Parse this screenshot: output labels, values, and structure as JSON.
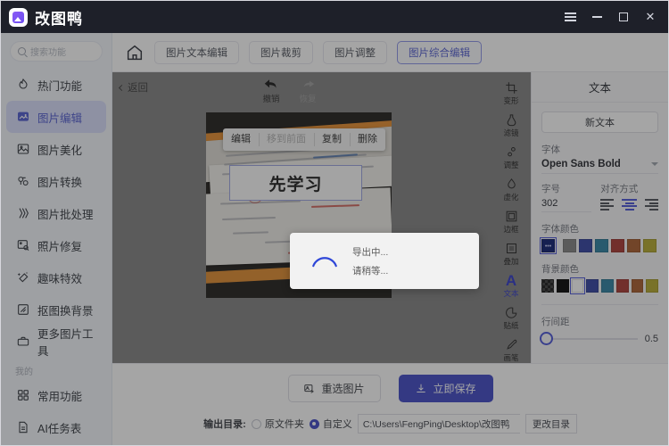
{
  "window": {
    "app_title": "改图鸭",
    "logo_icon": "duck-logo-icon",
    "menu_icon": "hamburger-menu-icon",
    "minimize_icon": "minimize-icon",
    "maximize_icon": "maximize-icon",
    "close_icon": "close-icon",
    "close_label": "✕"
  },
  "sidebar": {
    "search": {
      "placeholder": "搜索功能",
      "icon": "search-icon"
    },
    "items": [
      {
        "label": "热门功能",
        "icon": "flame-icon",
        "active": false
      },
      {
        "label": "图片编辑",
        "icon": "image-edit-icon",
        "active": true
      },
      {
        "label": "图片美化",
        "icon": "image-beautify-icon",
        "active": false
      },
      {
        "label": "图片转换",
        "icon": "image-convert-icon",
        "active": false
      },
      {
        "label": "图片批处理",
        "icon": "batch-process-icon",
        "active": false
      },
      {
        "label": "照片修复",
        "icon": "photo-repair-icon",
        "active": false
      },
      {
        "label": "趣味特效",
        "icon": "sparkle-effect-icon",
        "active": false
      },
      {
        "label": "抠图换背景",
        "icon": "cutout-background-icon",
        "active": false
      },
      {
        "label": "更多图片工具",
        "icon": "toolbox-icon",
        "active": false
      }
    ],
    "group_label": "我的",
    "my_items": [
      {
        "label": "常用功能",
        "icon": "grid-icon"
      },
      {
        "label": "AI任务表",
        "icon": "document-icon"
      }
    ]
  },
  "tabbar": {
    "home_icon": "home-icon",
    "tabs": [
      {
        "label": "图片文本编辑",
        "active": false
      },
      {
        "label": "图片裁剪",
        "active": false
      },
      {
        "label": "图片调整",
        "active": false
      },
      {
        "label": "图片综合编辑",
        "active": true
      }
    ]
  },
  "canvas": {
    "back_label": "返回",
    "back_icon": "chevron-left-icon",
    "undo": {
      "label": "撤销",
      "icon": "undo-arrow-icon",
      "enabled": true
    },
    "redo": {
      "label": "恢复",
      "icon": "redo-arrow-icon",
      "enabled": false
    },
    "context_menu": [
      {
        "label": "编辑",
        "disabled": false
      },
      {
        "label": "移到前面",
        "disabled": true
      },
      {
        "label": "复制",
        "disabled": false
      },
      {
        "label": "删除",
        "disabled": false
      }
    ],
    "text_overlay": "先学习"
  },
  "modal": {
    "title": "导出中...",
    "subtitle": "请稍等...",
    "spinner_icon": "loading-spinner-icon",
    "spinner_color": "#2f47d8"
  },
  "toolrail": [
    {
      "label": "变形",
      "icon": "transform-icon",
      "active": false
    },
    {
      "label": "滤镜",
      "icon": "filter-icon",
      "active": false
    },
    {
      "label": "调整",
      "icon": "adjust-icon",
      "active": false
    },
    {
      "label": "虚化",
      "icon": "blur-icon",
      "active": false
    },
    {
      "label": "边框",
      "icon": "border-icon",
      "active": false
    },
    {
      "label": "叠加",
      "icon": "overlay-icon",
      "active": false
    },
    {
      "label": "文本",
      "icon": "text-icon",
      "active": true
    },
    {
      "label": "贴纸",
      "icon": "sticker-icon",
      "active": false
    },
    {
      "label": "画笔",
      "icon": "brush-icon",
      "active": false
    }
  ],
  "props": {
    "title": "文本",
    "new_text_label": "新文本",
    "font_label": "字体",
    "font_value": "Open Sans Bold",
    "font_caret_icon": "chevron-down-icon",
    "size_label": "字号",
    "size_value": "302",
    "align_label": "对齐方式",
    "align_options": [
      {
        "name": "align-left",
        "active": false
      },
      {
        "name": "align-center",
        "active": true
      },
      {
        "name": "align-right",
        "active": false
      }
    ],
    "font_color_label": "字体颜色",
    "font_colors": [
      {
        "hex": "#0a1a6e",
        "selected": true,
        "type": "current"
      },
      {
        "hex": "#808080",
        "selected": false
      },
      {
        "hex": "#2f3fa0",
        "selected": false
      },
      {
        "hex": "#2a7fa0",
        "selected": false
      },
      {
        "hex": "#a8352f",
        "selected": false
      },
      {
        "hex": "#a85a2a",
        "selected": false
      },
      {
        "hex": "#b4a82a",
        "selected": false
      }
    ],
    "bg_color_label": "背景颜色",
    "bg_colors": [
      {
        "hex": "transparent",
        "selected": false,
        "type": "checker"
      },
      {
        "hex": "#000000",
        "selected": false
      },
      {
        "hex": "#ffffff",
        "selected": true
      },
      {
        "hex": "#2f3fa0",
        "selected": false
      },
      {
        "hex": "#2a7fa0",
        "selected": false
      },
      {
        "hex": "#a8352f",
        "selected": false
      },
      {
        "hex": "#a85a2a",
        "selected": false
      },
      {
        "hex": "#b4a82a",
        "selected": false
      }
    ],
    "line_spacing_label": "行间距",
    "line_spacing_value": "0.5",
    "accent_color": "#4851d6"
  },
  "bottom": {
    "reselect_label": "重选图片",
    "reselect_icon": "image-swap-icon",
    "save_label": "立即保存",
    "save_icon": "download-icon",
    "output_label": "输出目录:",
    "option_original": "原文件夹",
    "option_custom": "自定义",
    "selected_option": "自定义",
    "path_value": "C:\\Users\\FengPing\\Desktop\\改图鸭",
    "change_dir_label": "更改目录"
  }
}
